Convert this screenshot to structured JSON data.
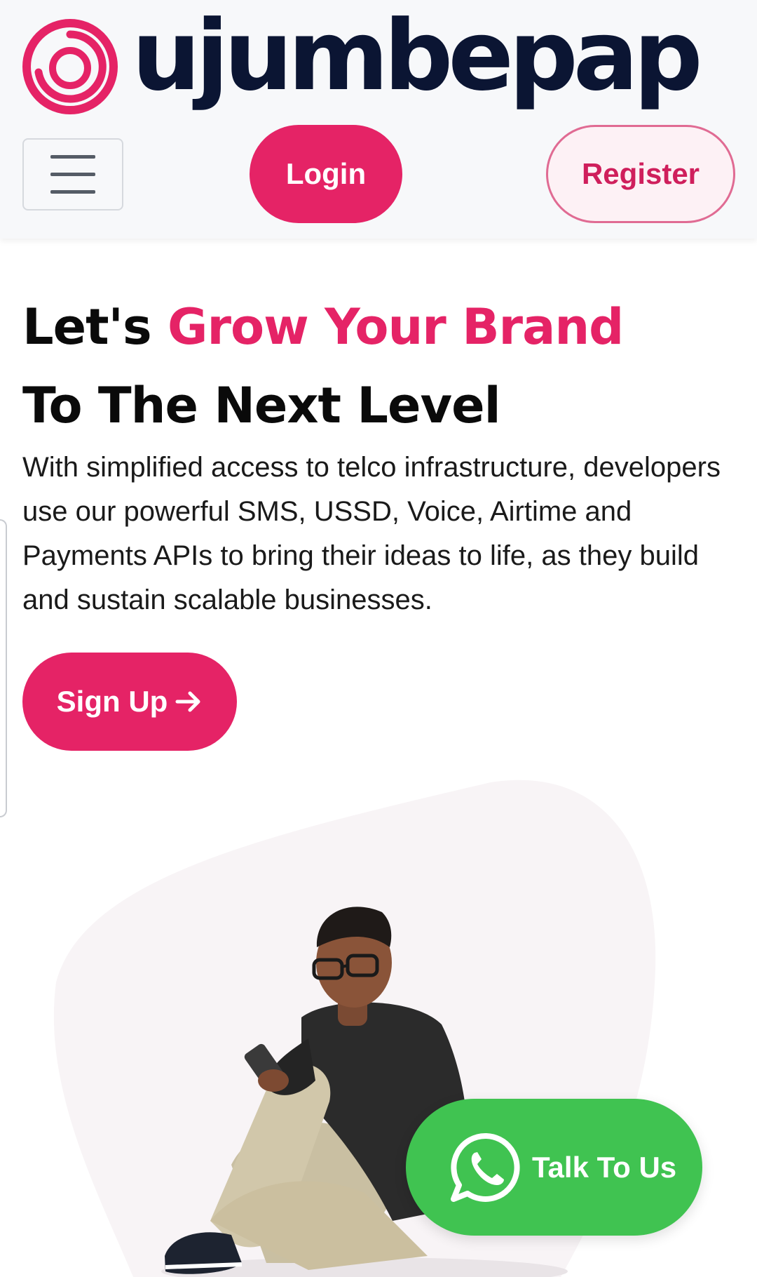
{
  "brand": {
    "name": "ujumbepap",
    "primary_color": "#e52366",
    "dark_color": "#0b1533",
    "logo_icon": "spiral-logo-icon"
  },
  "header": {
    "menu_icon": "hamburger-menu-icon",
    "login_label": "Login",
    "register_label": "Register"
  },
  "hero": {
    "title_part1": "Let's ",
    "title_accent": "Grow Your Brand",
    "title_line2": "To The Next Level",
    "description": "With simplified access to telco infrastructure, developers use our powerful SMS, USSD, Voice, Airtime and Payments APIs to bring their ideas to life, as they build and sustain scalable businesses.",
    "signup_label": "Sign Up",
    "signup_icon": "arrow-right-icon"
  },
  "chat": {
    "label": "Talk To Us",
    "icon": "whatsapp-icon",
    "color": "#40c351"
  }
}
